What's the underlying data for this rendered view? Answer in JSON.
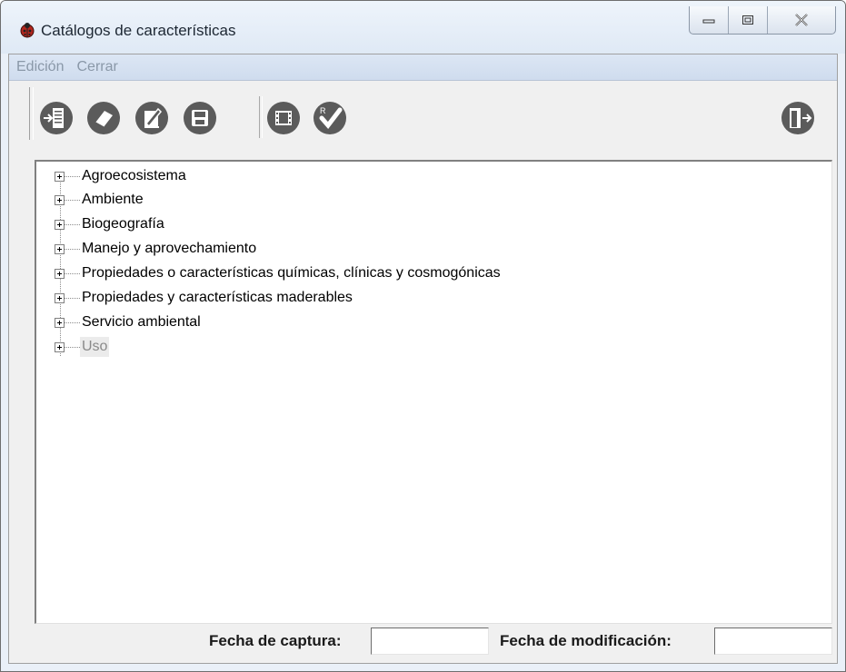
{
  "window": {
    "title": "Catálogos de características"
  },
  "menubar": {
    "items": [
      "Edición",
      "Cerrar"
    ]
  },
  "toolbar": {
    "icons": [
      "add-document-icon",
      "eraser-icon",
      "edit-icon",
      "save-icon",
      "film-icon",
      "check-icon",
      "exit-door-icon"
    ]
  },
  "tree": {
    "items": [
      "Agroecosistema",
      "Ambiente",
      "Biogeografía",
      "Manejo y aprovechamiento",
      "Propiedades o características químicas, clínicas y cosmogónicas",
      "Propiedades y características maderables",
      "Servicio ambiental",
      "Uso"
    ],
    "selected": "Uso"
  },
  "footer": {
    "fecha_captura_label": "Fecha de captura:",
    "fecha_captura_value": "",
    "fecha_modificacion_label": "Fecha de modificación:",
    "fecha_modificacion_value": ""
  },
  "colors": {
    "menubar_bg": "#dce6f4",
    "toolbar_icon": "#5a5a5a",
    "menu_text": "#8a98a8"
  }
}
